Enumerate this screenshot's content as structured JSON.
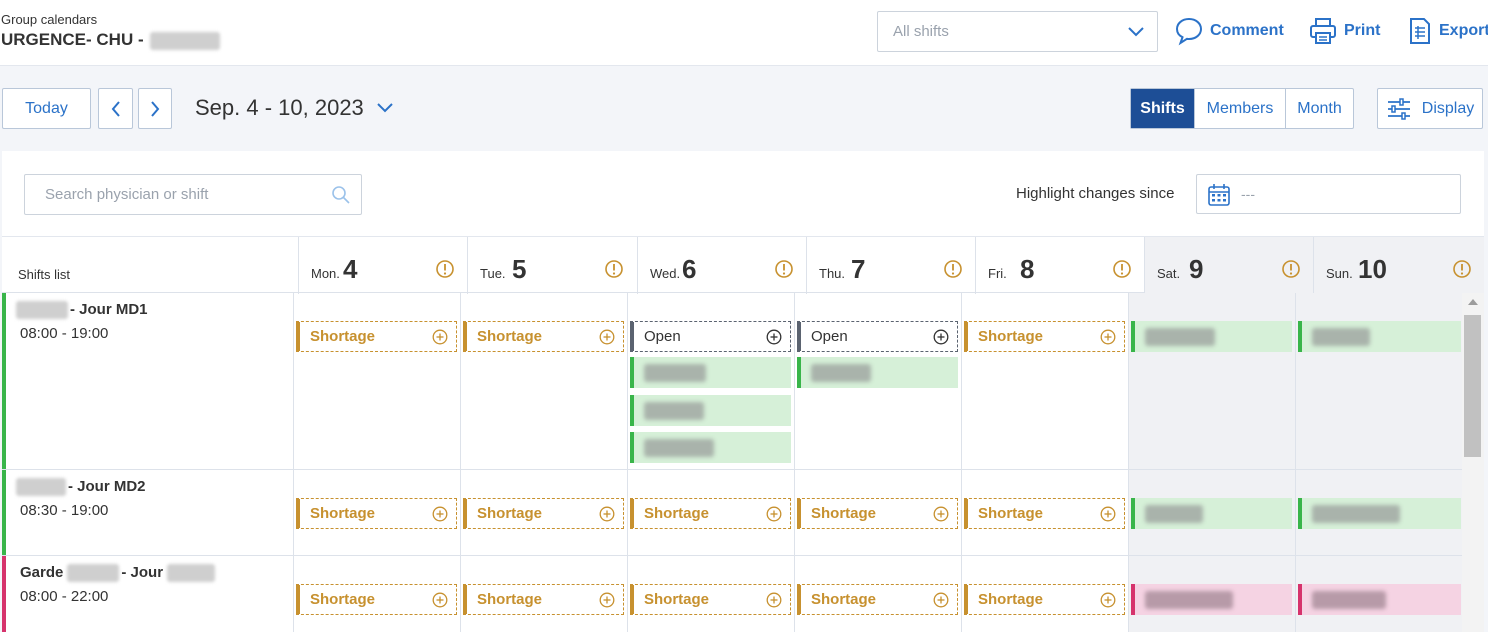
{
  "header": {
    "breadcrumb": "Group calendars",
    "group_title": "URGENCE- CHU -",
    "shift_filter": "All shifts",
    "actions": [
      {
        "label": "Comment",
        "icon": "comment-icon"
      },
      {
        "label": "Print",
        "icon": "print-icon"
      },
      {
        "label": "Export",
        "icon": "export-icon"
      }
    ]
  },
  "toolbar": {
    "today_label": "Today",
    "date_range": "Sep. 4 - 10, 2023",
    "views": [
      "Shifts",
      "Members",
      "Month"
    ],
    "active_view": "Shifts",
    "display_label": "Display"
  },
  "filters": {
    "search_placeholder": "Search physician or shift",
    "highlight_label": "Highlight changes since",
    "highlight_value": "---"
  },
  "grid": {
    "shifts_list_label": "Shifts list",
    "days": [
      {
        "name": "Mon.",
        "num": "4",
        "weekend": false
      },
      {
        "name": "Tue.",
        "num": "5",
        "weekend": false
      },
      {
        "name": "Wed.",
        "num": "6",
        "weekend": false
      },
      {
        "name": "Thu.",
        "num": "7",
        "weekend": false
      },
      {
        "name": "Fri.",
        "num": "8",
        "weekend": false
      },
      {
        "name": "Sat.",
        "num": "9",
        "weekend": true
      },
      {
        "name": "Sun.",
        "num": "10",
        "weekend": true
      }
    ],
    "rows": [
      {
        "name": "- Jour MD1",
        "time": "08:00 - 19:00",
        "color": "#39b54a",
        "cells": [
          [
            {
              "type": "shortage",
              "label": "Shortage"
            }
          ],
          [
            {
              "type": "shortage",
              "label": "Shortage"
            }
          ],
          [
            {
              "type": "open",
              "label": "Open"
            },
            {
              "type": "member"
            },
            {
              "type": "member"
            },
            {
              "type": "member"
            }
          ],
          [
            {
              "type": "open",
              "label": "Open"
            },
            {
              "type": "member"
            }
          ],
          [
            {
              "type": "shortage",
              "label": "Shortage"
            }
          ],
          [
            {
              "type": "member"
            }
          ],
          [
            {
              "type": "member"
            }
          ]
        ]
      },
      {
        "name": "- Jour MD2",
        "time": "08:30 - 19:00",
        "color": "#39b54a",
        "cells": [
          [
            {
              "type": "shortage",
              "label": "Shortage"
            }
          ],
          [
            {
              "type": "shortage",
              "label": "Shortage"
            }
          ],
          [
            {
              "type": "shortage",
              "label": "Shortage"
            }
          ],
          [
            {
              "type": "shortage",
              "label": "Shortage"
            }
          ],
          [
            {
              "type": "shortage",
              "label": "Shortage"
            }
          ],
          [
            {
              "type": "member"
            }
          ],
          [
            {
              "type": "member"
            }
          ]
        ]
      },
      {
        "name_prefix": "Garde",
        "name": "- Jour",
        "time": "08:00 - 22:00",
        "color": "#d6336c",
        "cells": [
          [
            {
              "type": "shortage",
              "label": "Shortage"
            }
          ],
          [
            {
              "type": "shortage",
              "label": "Shortage"
            }
          ],
          [
            {
              "type": "shortage",
              "label": "Shortage"
            }
          ],
          [
            {
              "type": "shortage",
              "label": "Shortage"
            }
          ],
          [
            {
              "type": "shortage",
              "label": "Shortage"
            }
          ],
          [
            {
              "type": "member",
              "variant": "pink"
            }
          ],
          [
            {
              "type": "member",
              "variant": "pink"
            }
          ]
        ]
      }
    ]
  },
  "colors": {
    "accent": "#2b72c8",
    "active_tab": "#1d4e96",
    "shortage": "#c7912f",
    "assigned": "#39b54a",
    "garde": "#d6336c"
  }
}
